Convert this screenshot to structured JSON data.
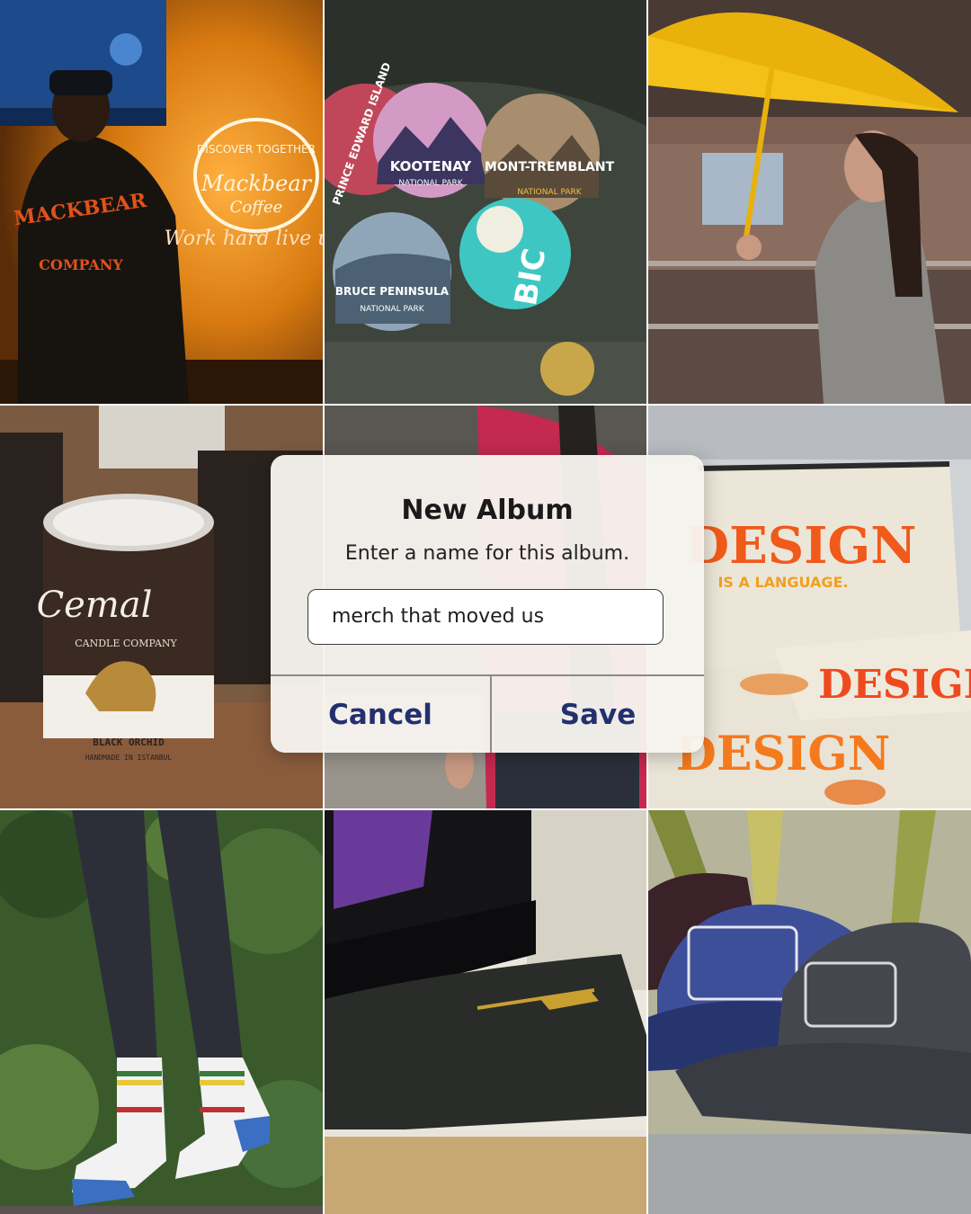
{
  "photos": [
    {
      "name": "neon-coffee-shop-photo",
      "caption_text": [
        "DISCOVER TOGETHER",
        "Mackbear",
        "Coffee",
        "Work hard live u"
      ],
      "shirt_text": [
        "MACKBEAR",
        "COMPANY"
      ]
    },
    {
      "name": "national-park-buttons-photo",
      "buttons": [
        "PRINCE EDWARD ISLAND",
        "KOOTENAY",
        "NATIONAL PARK",
        "MONT-TREMBLANT",
        "NATIONAL PARK",
        "BRUCE PENINSULA",
        "NATIONAL PARK",
        "BIC"
      ]
    },
    {
      "name": "yellow-umbrella-photo"
    },
    {
      "name": "candle-tins-photo",
      "label_text": [
        "Cemal",
        "CANDLE COMPANY",
        "BLACK ORCHID",
        "HANDMADE IN ISTANBUL"
      ]
    },
    {
      "name": "pink-jacket-photo"
    },
    {
      "name": "design-pouches-photo",
      "label_text": [
        "DESIGN",
        "IS A LANGUAGE."
      ]
    },
    {
      "name": "striped-socks-photo"
    },
    {
      "name": "pc-case-notebook-photo"
    },
    {
      "name": "trucker-caps-photo"
    }
  ],
  "dialog": {
    "title": "New Album",
    "message": "Enter a name for this album.",
    "input_value": "merch that moved us",
    "cancel_label": "Cancel",
    "save_label": "Save"
  },
  "colors": {
    "accent": "#24306e",
    "dialog_bg": "#f7f4ee"
  }
}
